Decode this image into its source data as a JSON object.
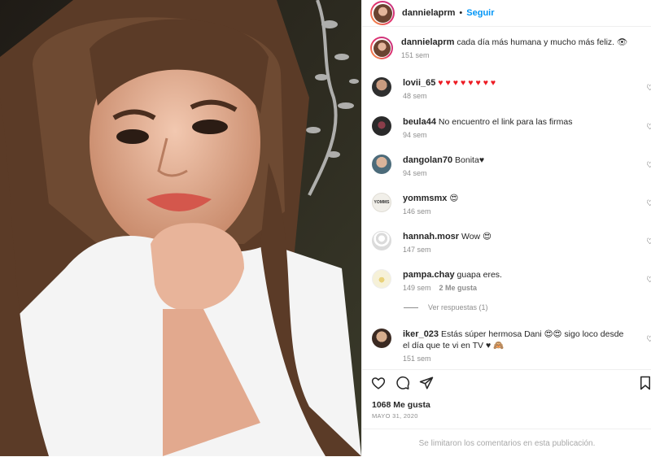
{
  "post": {
    "username": "dannielaprm",
    "separator": "•",
    "follow_label": "Seguir",
    "caption": "cada día más humana y mucho más feliz. 👁",
    "caption_time": "151 sem"
  },
  "comments": [
    {
      "user": "lovii_65",
      "text": "♥♥♥♥♥♥♥♥",
      "time": "48 sem",
      "likes": ""
    },
    {
      "user": "beula44",
      "text": "No encuentro el link para las firmas",
      "time": "94 sem",
      "likes": ""
    },
    {
      "user": "dangolan70",
      "text": "Bonita♥",
      "time": "94 sem",
      "likes": ""
    },
    {
      "user": "yommsmx",
      "text": "😍",
      "time": "146 sem",
      "likes": ""
    },
    {
      "user": "hannah.mosr",
      "text": "Wow 😍",
      "time": "147 sem",
      "likes": ""
    },
    {
      "user": "pampa.chay",
      "text": "guapa eres.",
      "time": "149 sem",
      "likes": "2 Me gusta"
    },
    {
      "user": "iker_023",
      "text": "Estás súper hermosa Dani 😍😍 sigo loco desde el día que te vi en TV ♥ 🙈",
      "time": "151 sem",
      "likes": ""
    }
  ],
  "view_replies": "Ver respuestas (1)",
  "likes_count": "1068 Me gusta",
  "date": "MAYO 31, 2020",
  "comments_limited": "Se limitaron los comentarios en esta publicación.",
  "avatar_text_yomms": "YOMMS",
  "colors": {
    "link": "#0095f6",
    "muted": "#8e8e8e",
    "heart": "#ed1c24"
  }
}
